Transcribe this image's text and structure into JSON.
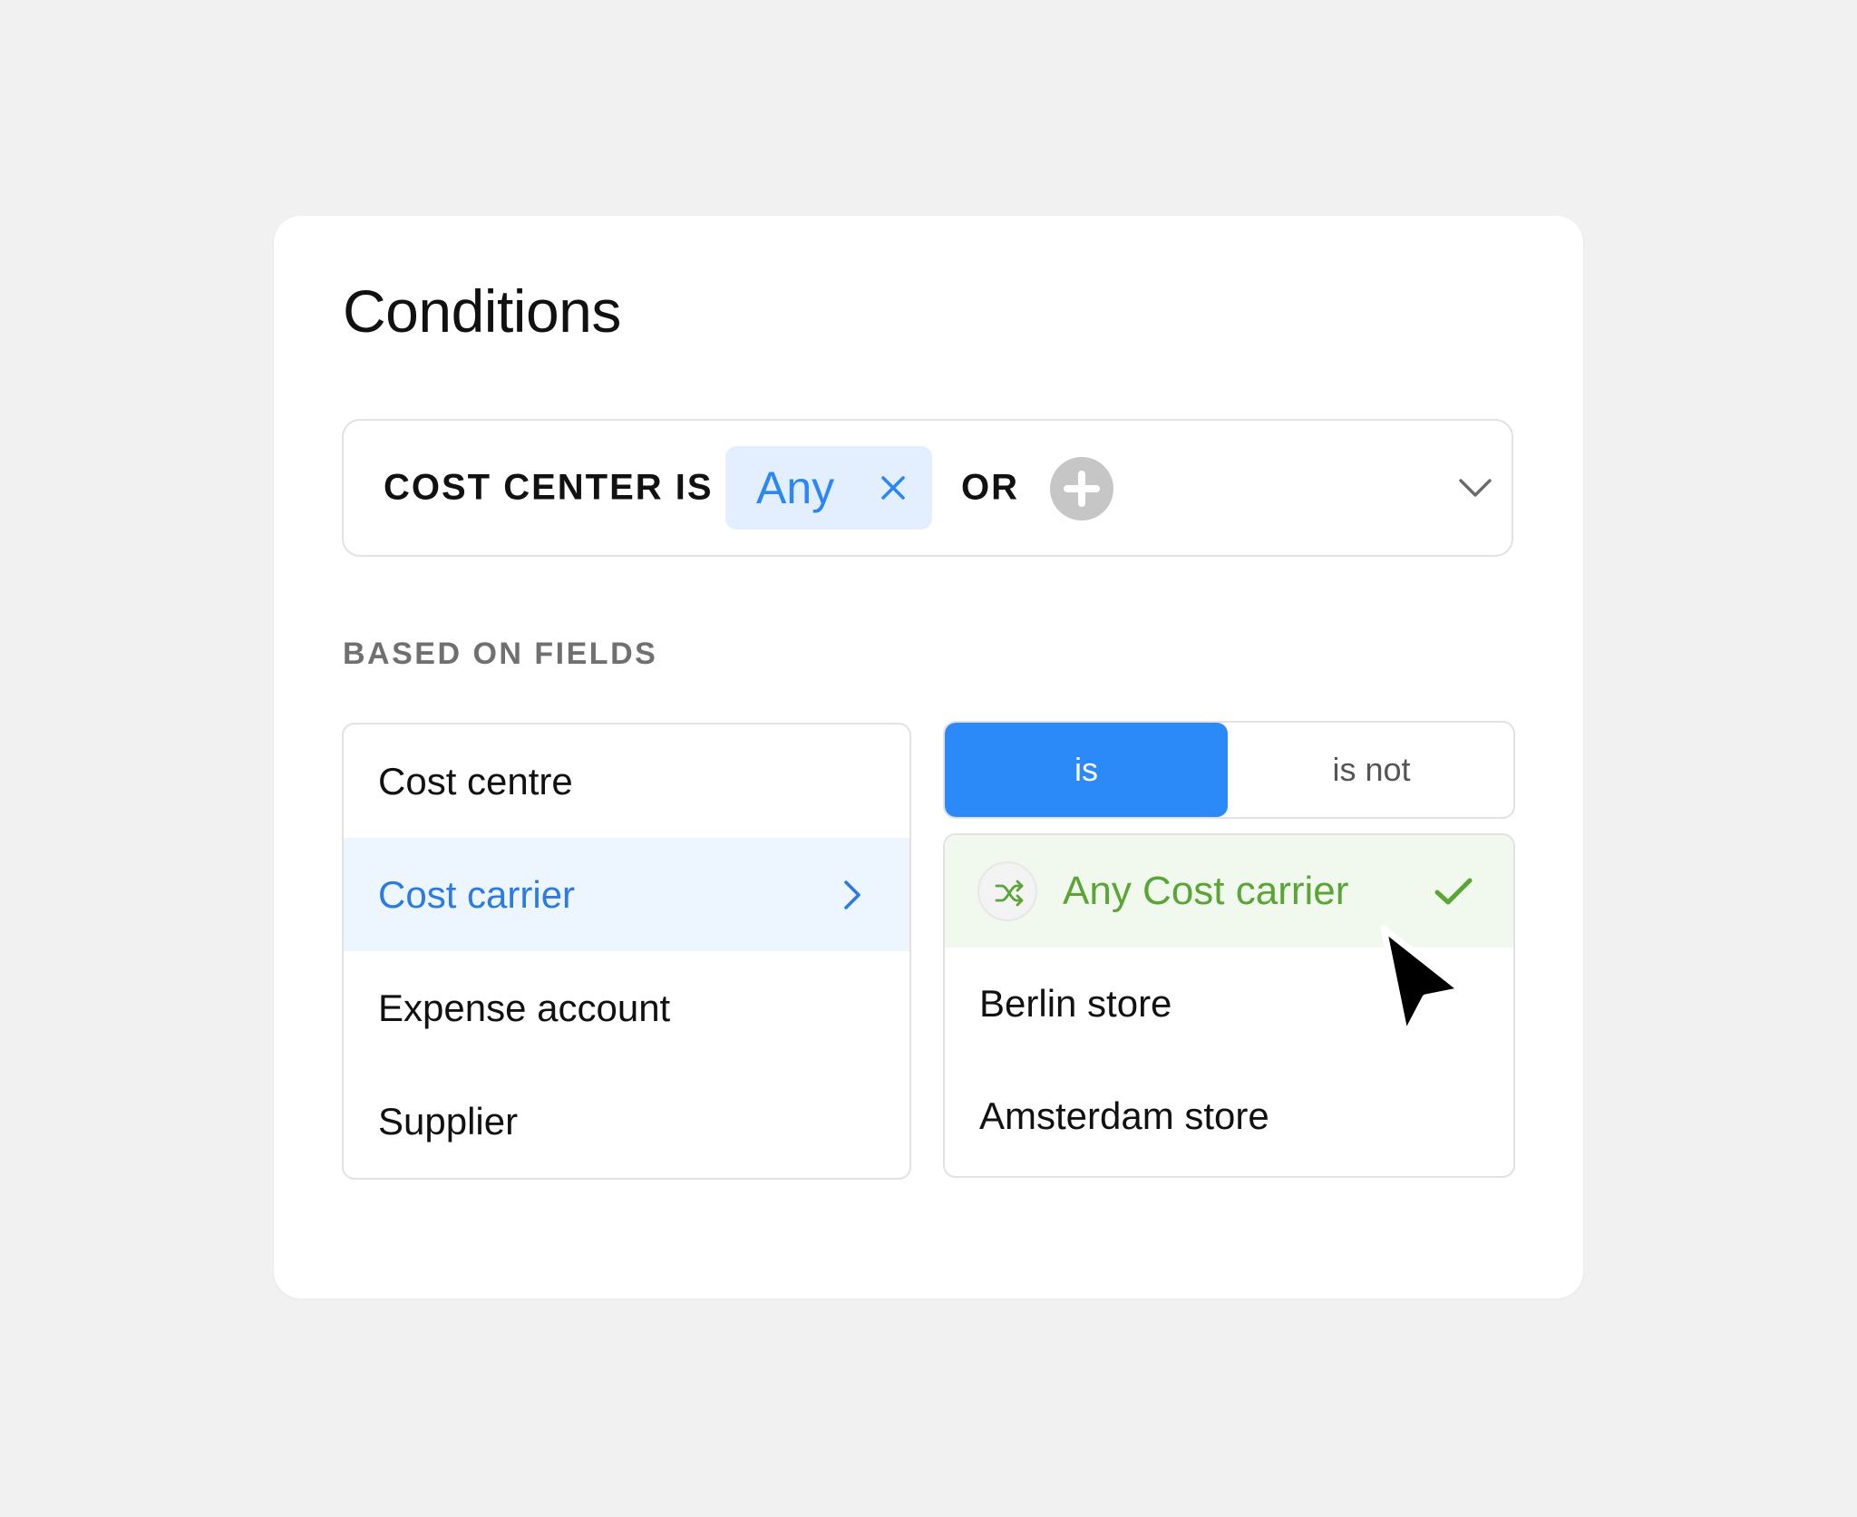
{
  "title": "Conditions",
  "condition_bar": {
    "label": "COST CENTER IS",
    "chip": {
      "label": "Any",
      "close_icon": "close-icon"
    },
    "or_label": "OR",
    "add_icon": "plus-circle-icon",
    "expand_icon": "chevron-down-icon"
  },
  "section_label": "BASED ON FIELDS",
  "fields": {
    "items": [
      {
        "label": "Cost centre",
        "selected": false
      },
      {
        "label": "Cost carrier",
        "selected": true
      },
      {
        "label": "Expense account",
        "selected": false
      },
      {
        "label": "Supplier",
        "selected": false
      }
    ],
    "selected_icon": "chevron-right-icon"
  },
  "operator": {
    "options": [
      "is",
      "is not"
    ],
    "selected": "is"
  },
  "values": {
    "items": [
      {
        "label": "Any Cost carrier",
        "selected": true,
        "icon": "shuffle-icon"
      },
      {
        "label": "Berlin store",
        "selected": false
      },
      {
        "label": "Amsterdam store",
        "selected": false
      }
    ],
    "check_icon": "check-icon"
  },
  "colors": {
    "background": "#f1f1f1",
    "accent_blue": "#2b8af7",
    "chip_background": "#e3efff",
    "selected_row_blue": "#edf5ff",
    "selected_row_green": "#f1f8ee",
    "success_green": "#5aa536",
    "muted_text": "#707070"
  }
}
